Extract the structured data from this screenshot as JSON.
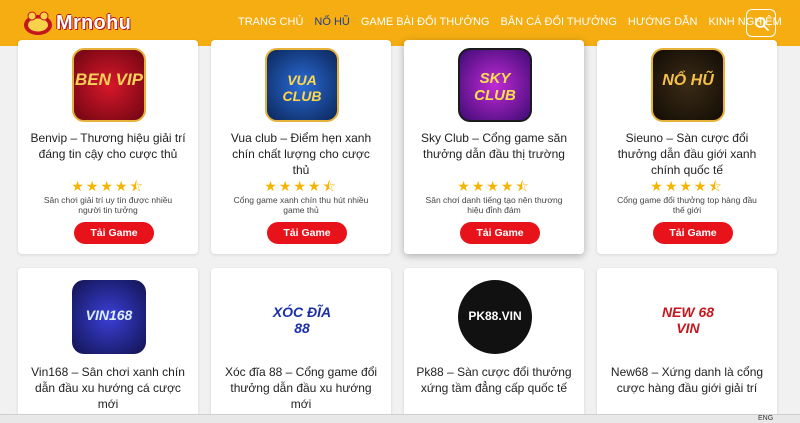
{
  "logo": {
    "text": "Mrnohu",
    "icon": "logo-emblem"
  },
  "nav": [
    {
      "label": "TRANG CHỦ",
      "active": false
    },
    {
      "label": "NỔ HŨ",
      "active": true
    },
    {
      "label": "GAME BÀI ĐỔI THƯỞNG",
      "active": false
    },
    {
      "label": "BẮN CÁ ĐỔI THƯỞNG",
      "active": false
    },
    {
      "label": "HƯỚNG DẪN",
      "active": false
    },
    {
      "label": "KINH NGHIỆM",
      "active": false
    }
  ],
  "search": {
    "icon": "search-icon"
  },
  "colors": {
    "header": "#f5ad12",
    "button": "#e8121a",
    "star": "#f5b400",
    "nav_active": "#1e3f8a"
  },
  "rating": {
    "value": 4.5,
    "max": 5
  },
  "cards": [
    {
      "logo_text": "BEN VIP",
      "title": "Benvip – Thương hiệu giải trí đáng tin cậy cho cược thủ",
      "stars": "★★★★⯪",
      "desc": "Sân chơi giải trí uy tín được nhiều người tin tưởng",
      "button": "Tải Game"
    },
    {
      "logo_text": "VUA CLUB",
      "title": "Vua club – Điểm hẹn xanh chín chất lượng cho cược thủ",
      "stars": "★★★★⯪",
      "desc": "Cổng game xanh chín thu hút nhiều game thủ",
      "button": "Tải Game"
    },
    {
      "logo_text": "SKY CLUB",
      "title": "Sky Club – Cổng game săn thưởng dẫn đầu thị trường",
      "stars": "★★★★⯪",
      "desc": "Sân chơi danh tiếng tạo nên thương hiệu đỉnh đám",
      "button": "Tải Game"
    },
    {
      "logo_text": "NỔ HŨ",
      "title": "Sieuno – Sàn cược đổi thưởng dẫn đầu giới xanh chính quốc tế",
      "stars": "★★★★⯪",
      "desc": "Cổng game đổi thưởng top hàng đầu thế giới",
      "button": "Tải Game"
    },
    {
      "logo_text": "VIN168",
      "title": "Vin168 – Sân chơi xanh chín dẫn đầu xu hướng cá cược mới",
      "stars": "★★★★⯪"
    },
    {
      "logo_text": "XÓC ĐĨA 88",
      "title": "Xóc đĩa 88 – Cổng game đổi thưởng dẫn đầu xu hướng mới",
      "stars": "★★★★⯪"
    },
    {
      "logo_text": "PK88.VIN",
      "title": "Pk88 – Sàn cược đổi thưởng xứng tầm đẳng cấp quốc tế",
      "stars": "★★★★⯪"
    },
    {
      "logo_text": "NEW 68 VIN",
      "title": "New68 – Xứng danh là cổng cược hàng đầu giới giải trí",
      "stars": "★★★★⯪"
    }
  ],
  "taskbar": {
    "lang": "ENG"
  }
}
